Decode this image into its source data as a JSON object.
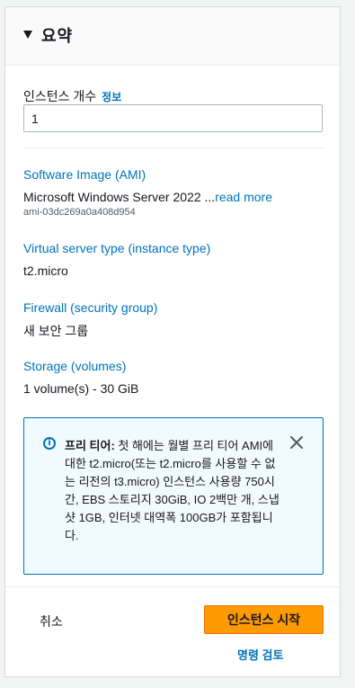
{
  "summary": {
    "title": "요약",
    "instance_count_label": "인스턴스 개수",
    "info_link": "정보",
    "instance_count_value": "1"
  },
  "software_image": {
    "label": "Software Image (AMI)",
    "value": "Microsoft Windows Server 2022 ...",
    "read_more": "read more",
    "ami_id": "ami-03dc269a0a408d954"
  },
  "instance_type": {
    "label": "Virtual server type (instance type)",
    "value": "t2.micro"
  },
  "firewall": {
    "label": "Firewall (security group)",
    "value": "새 보안 그룹"
  },
  "storage": {
    "label": "Storage (volumes)",
    "value": "1 volume(s) - 30 GiB"
  },
  "free_tier": {
    "title": "프리 티어:",
    "text": " 첫 해에는 월별 프리 티어 AMI에 대한 t2.micro(또는 t2.micro를 사용할 수 없는 리전의 t3.micro) 인스턴스 사용량 750시간, EBS 스토리지 30GiB, IO 2백만 개, 스냅샷 1GB, 인터넷 대역폭 100GB가 포함됩니다."
  },
  "footer": {
    "cancel": "취소",
    "launch": "인스턴스 시작",
    "review_commands": "명령 검토"
  },
  "colors": {
    "link": "#0073bb",
    "primary_button": "#ff9900",
    "info_background": "#f1faff"
  }
}
